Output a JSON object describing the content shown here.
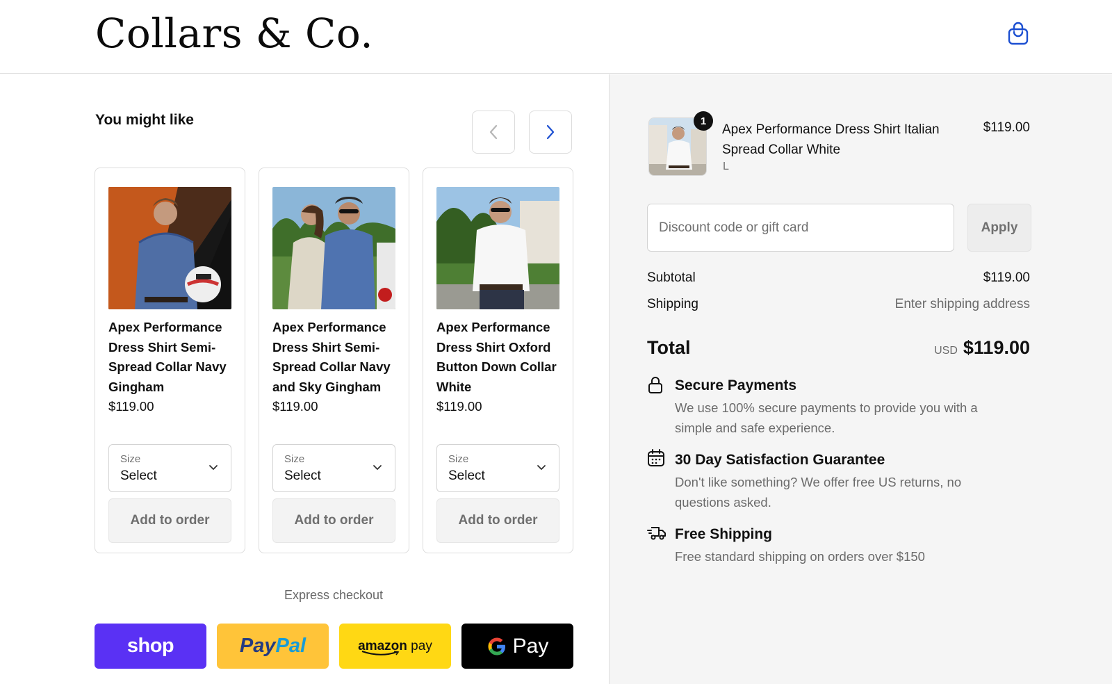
{
  "header": {
    "logo": "Collars & Co."
  },
  "upsell": {
    "heading": "You might like",
    "products": [
      {
        "title": "Apex Performance Dress Shirt Semi-Spread Collar Navy Gingham",
        "price": "$119.00",
        "size_label": "Size",
        "size_value": "Select",
        "add_label": "Add to order"
      },
      {
        "title": "Apex Performance Dress Shirt Semi-Spread Collar Navy and Sky Gingham",
        "price": "$119.00",
        "size_label": "Size",
        "size_value": "Select",
        "add_label": "Add to order"
      },
      {
        "title": "Apex Performance Dress Shirt Oxford Button Down Collar White",
        "price": "$119.00",
        "size_label": "Size",
        "size_value": "Select",
        "add_label": "Add to order"
      }
    ]
  },
  "express": {
    "heading": "Express checkout",
    "shop": "shop",
    "paypal_a": "Pay",
    "paypal_b": "Pal",
    "amazon_a": "amazon",
    "amazon_b": " pay",
    "gpay": "Pay"
  },
  "order": {
    "quantity": "1",
    "item_name": "Apex Performance Dress Shirt Italian Spread Collar White",
    "item_variant": "L",
    "item_price": "$119.00",
    "discount_placeholder": "Discount code or gift card",
    "apply_label": "Apply",
    "subtotal_label": "Subtotal",
    "subtotal_value": "$119.00",
    "shipping_label": "Shipping",
    "shipping_value": "Enter shipping address",
    "total_label": "Total",
    "total_currency": "USD",
    "total_value": "$119.00"
  },
  "features": [
    {
      "icon": "lock-icon",
      "title": "Secure Payments",
      "desc": "We use 100% secure payments to provide you with a simple and safe experience."
    },
    {
      "icon": "calendar-icon",
      "title": "30 Day Satisfaction Guarantee",
      "desc": "Don't like something? We offer free US returns, no questions asked."
    },
    {
      "icon": "delivery-truck-icon",
      "title": "Free Shipping",
      "desc": "Free standard shipping on orders over $150"
    }
  ],
  "colors": {
    "accent": "#1c4fd1",
    "shop": "#5a31f4",
    "paypal": "#ffc439",
    "amazon": "#ffd814",
    "gpay": "#000000",
    "sidebar_bg": "#f5f5f5"
  }
}
